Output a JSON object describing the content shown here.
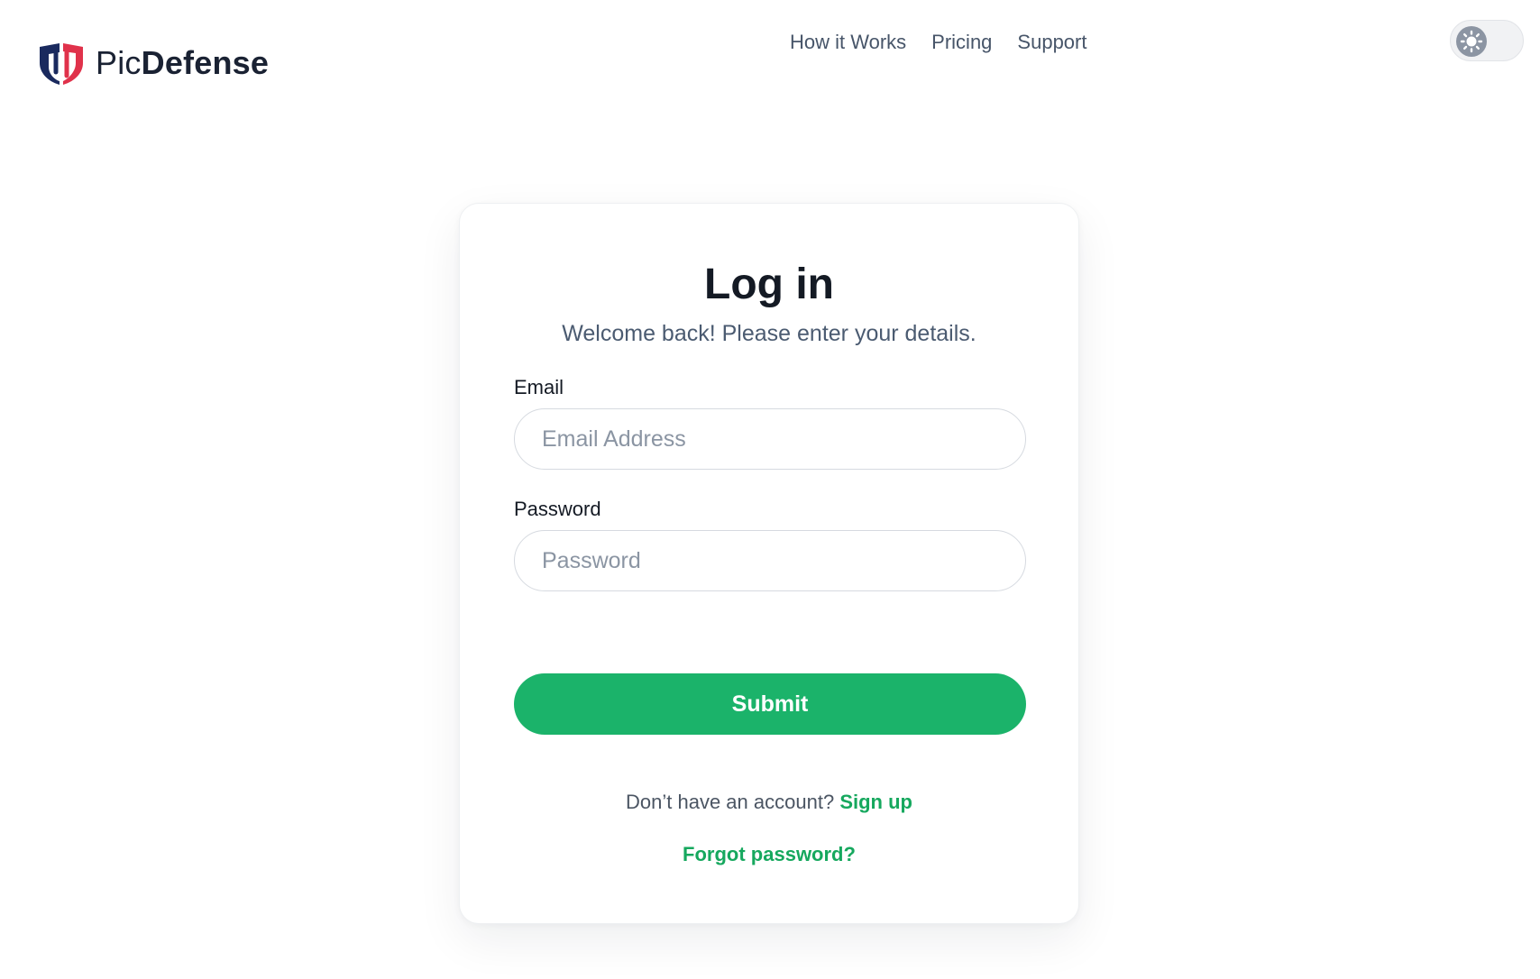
{
  "header": {
    "brand": {
      "regular": "Pic",
      "bold": "Defense"
    },
    "nav": [
      {
        "label": "How it Works"
      },
      {
        "label": "Pricing"
      },
      {
        "label": "Support"
      }
    ],
    "theme_toggle": {
      "icon": "sun-icon",
      "state": "light"
    }
  },
  "login": {
    "title": "Log in",
    "subtitle": "Welcome back! Please enter your details.",
    "email": {
      "label": "Email",
      "placeholder": "Email Address",
      "value": ""
    },
    "password": {
      "label": "Password",
      "placeholder": "Password",
      "value": ""
    },
    "submit_label": "Submit",
    "signup_prompt": "Don’t have an account?",
    "signup_link": "Sign up",
    "forgot_link": "Forgot password?"
  },
  "colors": {
    "accent": "#1bb36a",
    "link": "#16a85e",
    "logo_navy": "#1a2a5e",
    "logo_red": "#e0324b"
  }
}
